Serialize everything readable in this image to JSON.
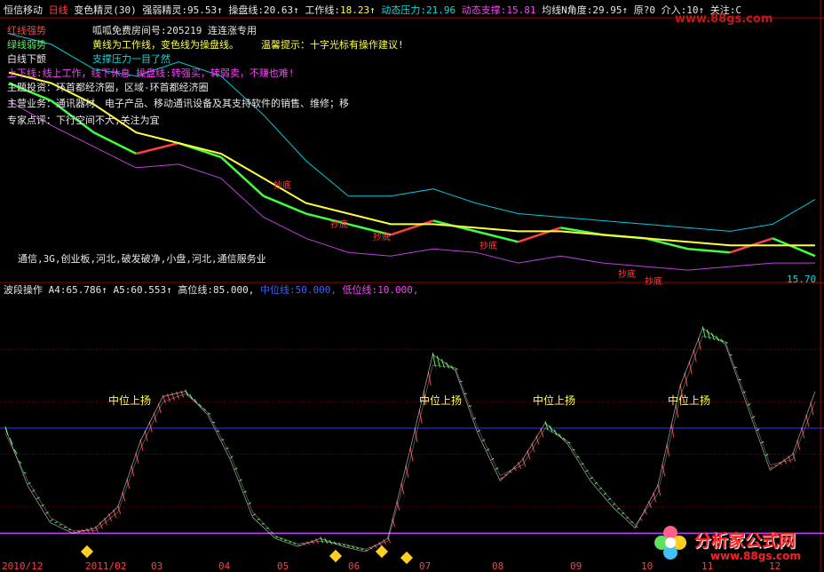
{
  "header": {
    "stock": "恒信移动",
    "period": "日线",
    "indicator": "变色精灵(30)",
    "strength_label": "强弱精灵:",
    "strength_value": "95.53↑",
    "control_label": "操盘线:",
    "control_value": "20.63↑",
    "work_label": "工作线:",
    "work_value": "18.23↑",
    "pressure_label": "动态压力:",
    "pressure_value": "21.96",
    "support_label": "动态支撑:",
    "support_value": "15.81",
    "angle_label": "均线N角度:",
    "angle_value": "29.95↑",
    "sell_label": "原?",
    "sell_value": "0",
    "buy_label": "介入:",
    "buy_value": "10↑",
    "focus_label": "关注:",
    "focus_value": "C"
  },
  "watermark_top": "www.88gs.com",
  "legend": {
    "red_line": "红线强势",
    "green_line": "绿线弱势",
    "white_line": "白线下颤",
    "hotline_label": "呱呱免费房间号:",
    "hotline_value": "205219",
    "hotline_suffix": "连连涨专用",
    "yellow_note": "黄线为工作线，变色线为操盘线。",
    "tip": "温馨提示：十字光标有操作建议!",
    "support_note": "支撑压力一目了然",
    "rule": "上下线:线上工作，线下休息  操盘线:转强买，转弱卖，不赚也难!",
    "theme": "主题投资：环首都经济圈，区域-环首都经济圈",
    "business": "主营业务：通讯器材、电子产品、移动通讯设备及其支持软件的销售、维修；移",
    "comment": "专家点评：下行空间不大,关注为宜",
    "concepts": "通信,3G,创业板,河北,破发破净,小盘,河北,通信服务业"
  },
  "price_label": "15.70",
  "lower_header": {
    "title": "波段操作",
    "a4_label": "A4:",
    "a4_value": "65.786↑",
    "a5_label": "A5:",
    "a5_value": "60.553↑",
    "high_label": "高位线:",
    "high_value": "85.000,",
    "mid_label": "中位线:",
    "mid_value": "50.000,",
    "low_label": "低位线:",
    "low_value": "10.000,"
  },
  "signals": [
    "中位上扬",
    "中位上扬",
    "中位上扬",
    "中位上扬"
  ],
  "buy_marks": [
    "抄底",
    "抄底",
    "抄底",
    "抄底",
    "抄底",
    "抄底"
  ],
  "dates": [
    "2010/12",
    "2011/02",
    "03",
    "04",
    "05",
    "06",
    "07",
    "08",
    "09",
    "10",
    "11",
    "12"
  ],
  "footer_brand": "分析家公式网",
  "footer_url": "www.88gs.com",
  "colors": {
    "background": "#000000",
    "rising": "#ff4040",
    "falling": "#40ff40",
    "work_line": "#ffff40",
    "pressure": "#00c8e0",
    "support": "#c040e0",
    "mid_line": "#3030ff",
    "low_line": "#c040ff",
    "grid": "#800000"
  },
  "chart_data": [
    {
      "type": "line",
      "series": [
        {
          "name": "操盘线",
          "values": [
            20.6,
            20.1,
            19.2,
            18.6,
            18.9,
            18.5,
            17.4,
            16.9,
            16.6,
            16.3,
            16.7,
            16.4,
            16.1,
            16.5,
            16.3,
            16.2,
            15.9,
            15.8,
            16.2,
            15.7
          ]
        },
        {
          "name": "工作线",
          "values": [
            20.9,
            20.6,
            20.0,
            19.2,
            18.9,
            18.6,
            17.9,
            17.2,
            16.9,
            16.6,
            16.6,
            16.5,
            16.4,
            16.4,
            16.3,
            16.2,
            16.1,
            16.0,
            16.0,
            16.0
          ]
        },
        {
          "name": "动态压力",
          "values": [
            22.0,
            21.7,
            21.0,
            20.8,
            21.2,
            20.8,
            19.7,
            18.4,
            17.4,
            17.4,
            17.6,
            17.2,
            16.9,
            16.8,
            16.7,
            16.6,
            16.5,
            16.4,
            16.6,
            17.3
          ]
        },
        {
          "name": "动态支撑",
          "values": [
            20.1,
            19.4,
            18.8,
            18.2,
            18.3,
            17.9,
            16.8,
            16.2,
            15.8,
            15.7,
            15.9,
            15.8,
            15.5,
            15.7,
            15.5,
            15.4,
            15.3,
            15.4,
            15.5,
            15.5
          ]
        }
      ]
    },
    {
      "type": "line",
      "ylim": [
        0,
        100
      ],
      "hlines": {
        "high": 85.0,
        "mid": 50.0,
        "low": 10.0
      },
      "series": [
        {
          "name": "A4",
          "values": [
            50,
            28,
            14,
            10,
            12,
            20,
            45,
            62,
            64,
            55,
            38,
            16,
            8,
            5,
            8,
            5,
            3,
            8,
            42,
            78,
            72,
            48,
            30,
            38,
            52,
            44,
            30,
            20,
            12,
            28,
            66,
            88,
            82,
            58,
            34,
            40,
            64
          ]
        },
        {
          "name": "A5",
          "values": [
            48,
            30,
            16,
            11,
            11,
            18,
            42,
            60,
            63,
            56,
            40,
            18,
            9,
            6,
            7,
            6,
            4,
            7,
            38,
            74,
            73,
            50,
            32,
            36,
            50,
            45,
            32,
            22,
            13,
            25,
            62,
            85,
            83,
            60,
            36,
            38,
            60
          ]
        }
      ]
    }
  ]
}
